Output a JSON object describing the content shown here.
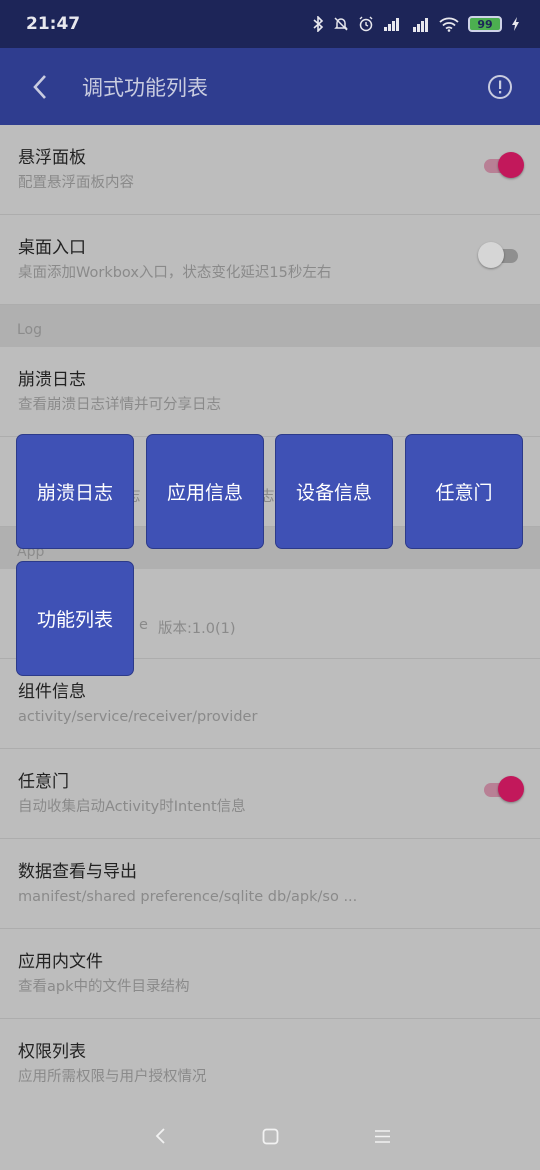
{
  "status_bar": {
    "time": "21:47",
    "battery_level": "99"
  },
  "header": {
    "title": "调式功能列表"
  },
  "rows": [
    {
      "title": "悬浮面板",
      "subtitle": "配置悬浮面板内容"
    },
    {
      "title": "桌面入口",
      "subtitle": "桌面添加Workbox入口，状态变化延迟15秒左右"
    },
    {
      "title": "崩溃日志",
      "subtitle": "查看崩溃日志详情并可分享日志"
    },
    {
      "title": "",
      "subtitle": ""
    },
    {
      "title": "",
      "subtitle": "版本:1.0(1)"
    },
    {
      "title": "组件信息",
      "subtitle": "activity/service/receiver/provider"
    },
    {
      "title": "任意门",
      "subtitle": "自动收集启动Activity时Intent信息"
    },
    {
      "title": "数据查看与导出",
      "subtitle": "manifest/shared preference/sqlite db/apk/so ..."
    },
    {
      "title": "应用内文件",
      "subtitle": "查看apk中的文件目录结构"
    },
    {
      "title": "权限列表",
      "subtitle": "应用所需权限与用户授权情况"
    }
  ],
  "toggles": {
    "floating_panel": true,
    "desktop_entry": false,
    "any_door": true
  },
  "sections": {
    "log": "Log",
    "app": "App"
  },
  "partial_texts": {
    "row4_fragment_a": "志",
    "row4_fragment_b": "志",
    "row5_fragment": "e"
  },
  "floating_buttons": [
    "崩溃日志",
    "应用信息",
    "设备信息",
    "任意门",
    "功能列表"
  ],
  "colors": {
    "status_bar": "#1d2558",
    "app_bar": "#2f3d8f",
    "float_button": "#3f51b5",
    "toggle_on": "#c2185b"
  }
}
